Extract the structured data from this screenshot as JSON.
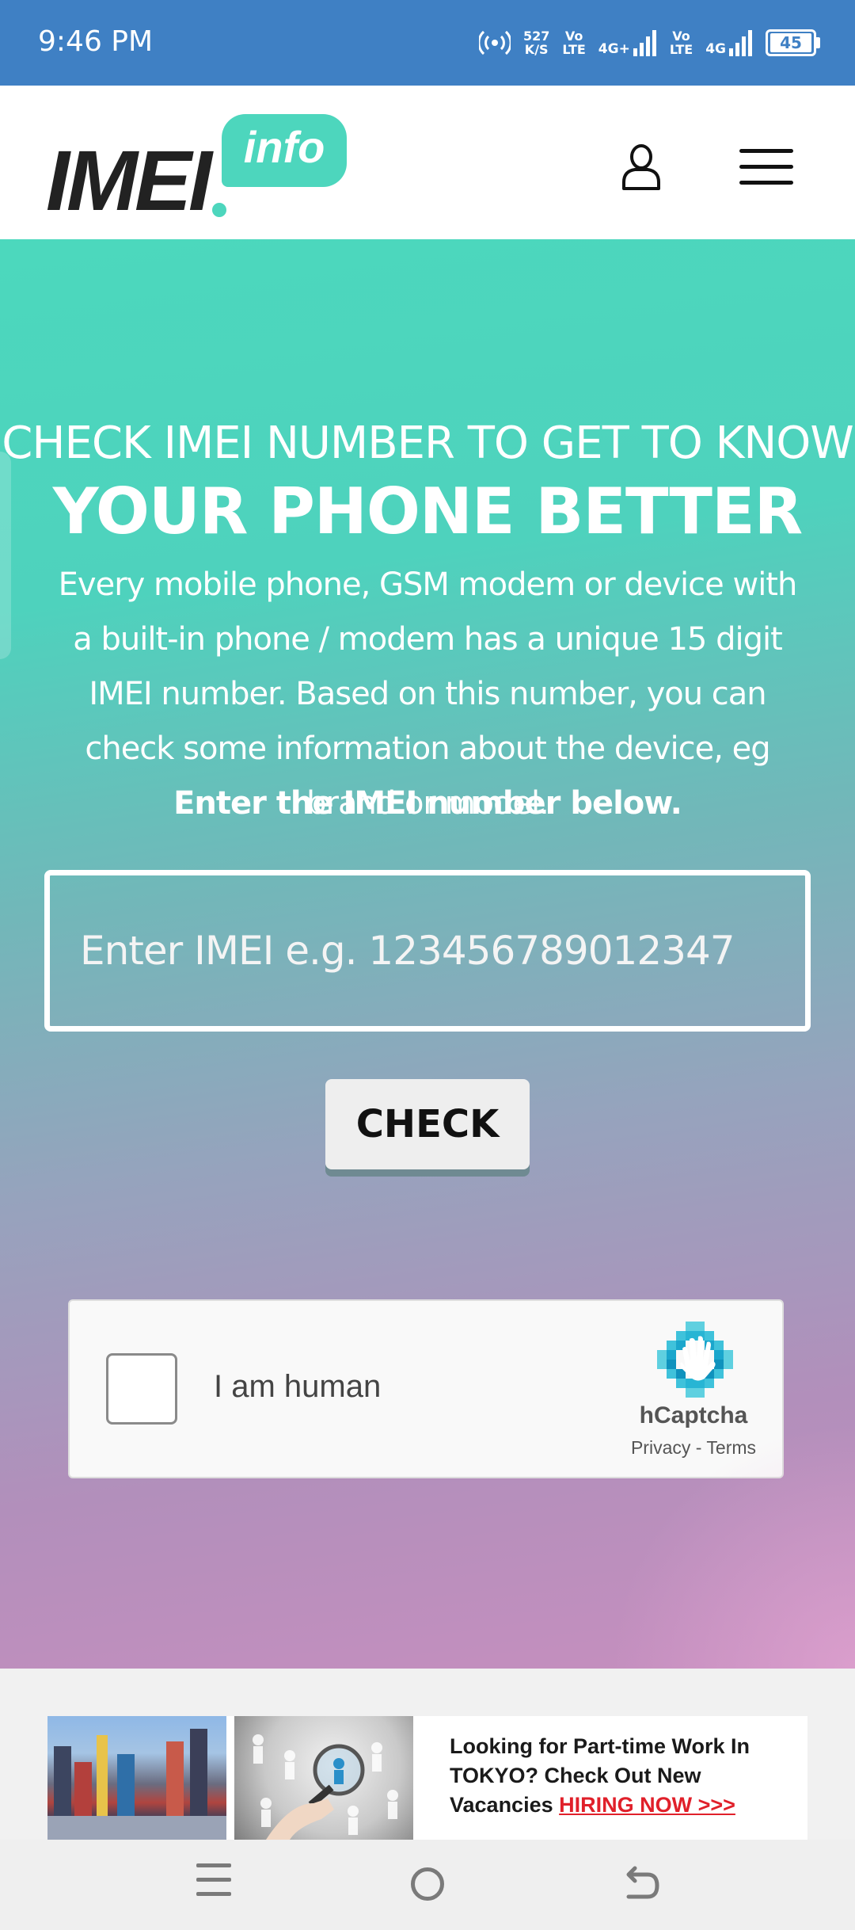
{
  "status_bar": {
    "time": "9:46 PM",
    "network_speed_value": "527",
    "network_speed_unit": "K/S",
    "sim1_volte_top": "Vo",
    "sim1_volte_bottom": "LTE",
    "sim1_network": "4G+",
    "sim2_volte_top": "Vo",
    "sim2_volte_bottom": "LTE",
    "sim2_network": "4G",
    "battery_level": "45"
  },
  "header": {
    "logo_main": "IMEI",
    "logo_badge": "info"
  },
  "hero": {
    "headline_line1": "CHECK IMEI NUMBER TO GET TO KNOW",
    "headline_line2": "YOUR PHONE BETTER",
    "description": "Every mobile phone, GSM modem or device with a built-in phone / modem has a unique 15 digit IMEI number. Based on this number, you can check some information about the device, eg brand or model.",
    "instruction": "Enter the IMEI number below.",
    "input_placeholder": "Enter IMEI e.g. 123456789012347",
    "input_value": "",
    "check_button_label": "CHECK"
  },
  "captcha": {
    "label": "I am human",
    "brand": "hCaptcha",
    "privacy_link": "Privacy",
    "separator": " - ",
    "terms_link": "Terms"
  },
  "ad": {
    "line1": "Looking for Part-time Work In",
    "line2": "TOKYO? Check Out New",
    "line3_prefix": "Vacancies ",
    "line3_highlight": "HIRING NOW >>>"
  },
  "colors": {
    "status_bar": "#3f80c4",
    "brand_teal": "#4dd6bd",
    "hero_gradient_start": "#4cd8bd",
    "hero_gradient_end": "#c68fbf",
    "ad_highlight": "#e0202a"
  },
  "icons": {
    "hotspot": "hotspot-icon",
    "signal": "signal-strength-icon",
    "battery": "battery-icon",
    "user": "user-icon",
    "menu": "hamburger-menu-icon",
    "captcha_logo": "hcaptcha-hand-icon",
    "nav_recent": "recent-apps-icon",
    "nav_home": "home-icon",
    "nav_back": "back-icon"
  }
}
